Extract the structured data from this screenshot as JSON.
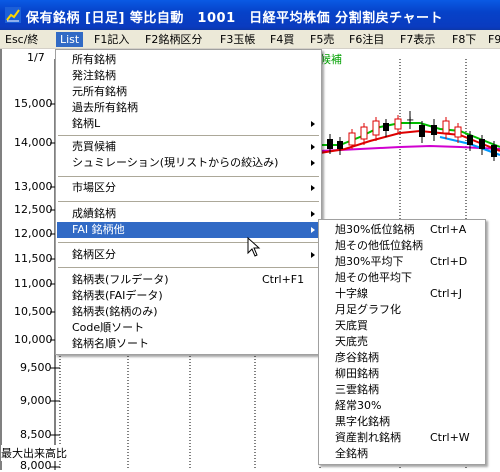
{
  "window": {
    "title": "保有銘柄 [日足] 等比自動　1001　日経平均株価 分割割戻チャート"
  },
  "menubar": {
    "items": [
      "Esc/終",
      "List",
      "F1記入",
      "F2銘柄区分",
      "F3玉帳",
      "F4買",
      "F5売",
      "F6注目",
      "F7表示",
      "F8下",
      "F9"
    ],
    "active": "List"
  },
  "chart": {
    "date_label": "1/7",
    "legend_fragment": "候補",
    "bottom_label": "最大出来高比",
    "y_ticks": [
      "15,000",
      "14,000",
      "13,000",
      "12,500",
      "12,000",
      "11,500",
      "11,000",
      "10,500",
      "10,000",
      "9,500",
      "9,000",
      "8,500",
      "8,000"
    ],
    "colors": {
      "ma_short": "#00bb00",
      "ma_mid": "#dd0000",
      "ma_long": "#d000d0",
      "ma_extra": "#0099ff",
      "candle_up": "#dd0000",
      "candle_down": "#000000"
    }
  },
  "list_menu": {
    "items": [
      {
        "label": "所有銘柄"
      },
      {
        "label": "発注銘柄"
      },
      {
        "label": "元所有銘柄"
      },
      {
        "label": "過去所有銘柄"
      },
      {
        "label": "銘柄L",
        "submenu": true
      },
      {
        "separator": true
      },
      {
        "label": "売買候補",
        "submenu": true
      },
      {
        "label": "シュミレーション(現リストからの絞込み)",
        "submenu": true
      },
      {
        "separator": true
      },
      {
        "label": "市場区分",
        "submenu": true
      },
      {
        "separator": true
      },
      {
        "label": "成績銘柄",
        "submenu": true
      },
      {
        "label": "FAI 銘柄他",
        "submenu": true,
        "highlighted": true
      },
      {
        "separator": true
      },
      {
        "label": "銘柄区分",
        "submenu": true
      },
      {
        "separator": true
      },
      {
        "label": "銘柄表(フルデータ)",
        "shortcut": "Ctrl+F1"
      },
      {
        "label": "銘柄表(FAIデータ)"
      },
      {
        "label": "銘柄表(銘柄のみ)"
      },
      {
        "label": "Code順ソート"
      },
      {
        "label": "銘柄名順ソート"
      }
    ]
  },
  "fai_submenu": {
    "items": [
      {
        "label": "旭30%低位銘柄",
        "shortcut": "Ctrl+A"
      },
      {
        "label": "旭その他低位銘柄"
      },
      {
        "label": "旭30%平均下",
        "shortcut": "Ctrl+D"
      },
      {
        "label": "旭その他平均下"
      },
      {
        "label": "十字線",
        "shortcut": "Ctrl+J"
      },
      {
        "label": "月足グラフ化"
      },
      {
        "label": "天底買"
      },
      {
        "label": "天底売"
      },
      {
        "label": "彦谷銘柄"
      },
      {
        "label": "柳田銘柄"
      },
      {
        "label": "三雲銘柄"
      },
      {
        "label": "経常30%"
      },
      {
        "label": "黒字化銘柄"
      },
      {
        "label": "資産割れ銘柄",
        "shortcut": "Ctrl+W"
      },
      {
        "label": "全銘柄"
      }
    ]
  }
}
